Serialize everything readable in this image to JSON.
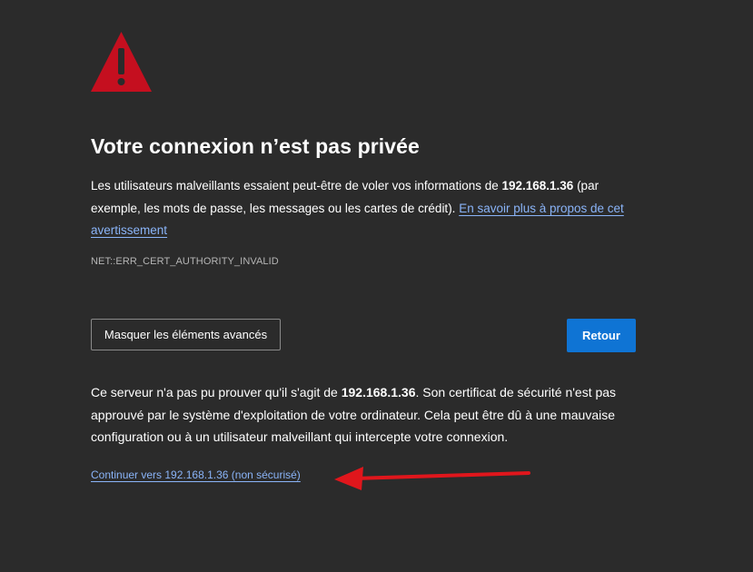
{
  "title": "Votre connexion n’est pas privée",
  "intro": {
    "before": "Les utilisateurs malveillants essaient peut-être de voler vos informations de ",
    "host": "192.168.1.36",
    "after": " (par exemple, les mots de passe, les messages ou les cartes de crédit). ",
    "learn_more_link": "En savoir plus à propos de cet avertissement"
  },
  "error_code": "NET::ERR_CERT_AUTHORITY_INVALID",
  "buttons": {
    "advanced_label": "Masquer les éléments avancés",
    "back_label": "Retour"
  },
  "details": {
    "before": "Ce serveur n'a pas pu prouver qu'il s'agit de ",
    "host": "192.168.1.36",
    "after": ". Son certificat de sécurité n'est pas approuvé par le système d'exploitation de votre ordinateur. Cela peut être dû à une mauvaise configuration ou à un utilisateur malveillant qui intercepte votre connexion."
  },
  "proceed_link": "Continuer vers 192.168.1.36 (non sécurisé)",
  "icons": {
    "warning": "warning-triangle-icon",
    "annotation": "red-arrow-annotation"
  },
  "colors": {
    "background": "#2b2b2b",
    "warning": "#c50f1f",
    "link": "#8ab4f8",
    "primary_button": "#0f74d4",
    "annotation_arrow": "#e0161c"
  }
}
